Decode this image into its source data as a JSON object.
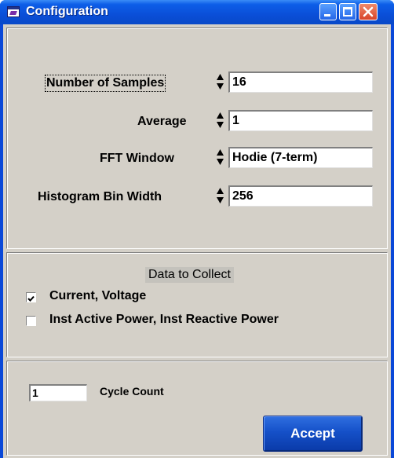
{
  "window": {
    "title": "Configuration"
  },
  "settings": {
    "num_samples": {
      "label": "Number of Samples",
      "value": "16"
    },
    "average": {
      "label": "Average",
      "value": "1"
    },
    "fft_window": {
      "label": "FFT Window",
      "value": "Hodie (7-term)"
    },
    "histogram_bin_width": {
      "label": "Histogram Bin Width",
      "value": "256"
    }
  },
  "data_to_collect": {
    "title": "Data to Collect",
    "options": [
      {
        "label": "Current, Voltage",
        "checked": true
      },
      {
        "label": "Inst Active Power, Inst Reactive Power",
        "checked": false
      }
    ]
  },
  "cycle": {
    "value": "1",
    "label": "Cycle Count"
  },
  "accept_label": "Accept",
  "colors": {
    "title_bar": "#0a4fd8",
    "dialog_face": "#d4d0c8",
    "accept_button": "#1550c8",
    "close_button": "#d8442a"
  }
}
